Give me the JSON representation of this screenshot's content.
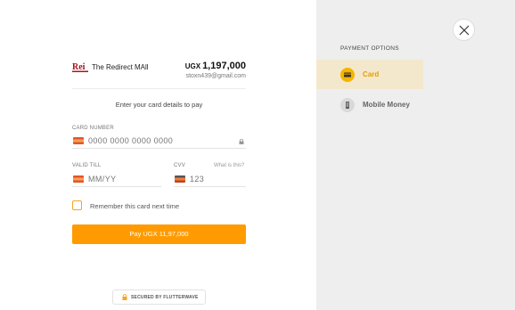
{
  "merchant": {
    "logo_text": "Rei",
    "name": "The Redirect MAll",
    "currency": "UGX",
    "amount": "1,197,000",
    "email": "stoxn439@gmail.com"
  },
  "form": {
    "instruction": "Enter your card details to pay",
    "card_number_label": "CARD NUMBER",
    "card_number_placeholder": "0000 0000 0000 0000",
    "valid_till_label": "VALID TILL",
    "valid_till_placeholder": "MM/YY",
    "cvv_label": "CVV",
    "cvv_placeholder": "123",
    "cvv_help": "What is this?",
    "remember_label": "Remember this card next time",
    "pay_label": "Pay UGX 11,97,000"
  },
  "footer": {
    "secured_label": "SECURED BY FLUTTERWAVE"
  },
  "payment_options": {
    "title": "PAYMENT OPTIONS",
    "items": [
      {
        "label": "Card",
        "icon": "card-icon",
        "active": true
      },
      {
        "label": "Mobile Money",
        "icon": "phone-icon",
        "active": false
      }
    ]
  },
  "colors": {
    "accent": "#ff9b00",
    "active_option_bg": "#f4e8cc",
    "sidebar_bg": "#eeeeee"
  }
}
